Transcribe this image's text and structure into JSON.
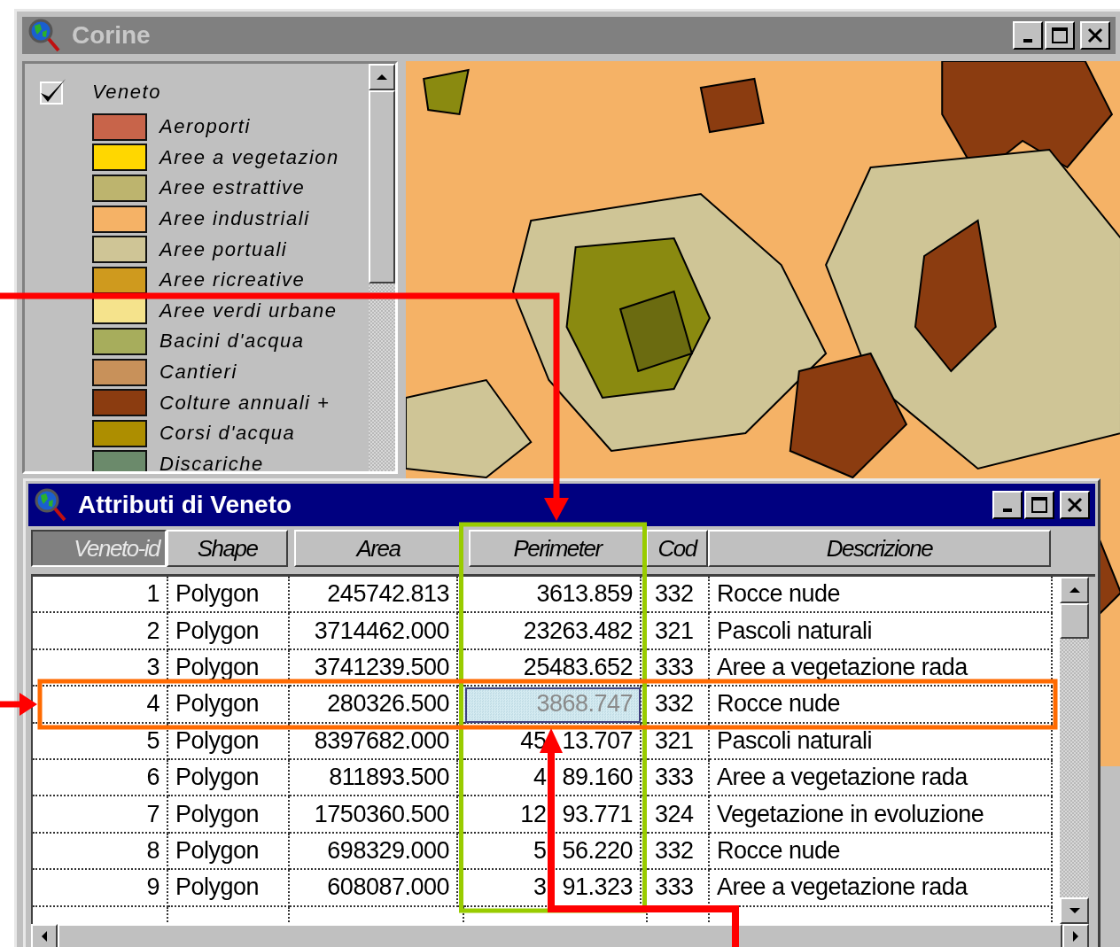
{
  "map_window": {
    "title": "Corine",
    "legend": {
      "layer": {
        "name": "Veneto",
        "visible": true
      },
      "items": [
        {
          "label": "Aeroporti",
          "color": "#c8644a"
        },
        {
          "label": "Aree a vegetazion",
          "color": "#ffd700"
        },
        {
          "label": "Aree estrattive",
          "color": "#bdb46e"
        },
        {
          "label": "Aree industriali",
          "color": "#f5b266"
        },
        {
          "label": "Aree portuali",
          "color": "#cfc596"
        },
        {
          "label": "Aree ricreative",
          "color": "#cf9a1e"
        },
        {
          "label": "Aree verdi urbane",
          "color": "#f5e38c"
        },
        {
          "label": "Bacini d'acqua",
          "color": "#a7ad5c"
        },
        {
          "label": "Cantieri",
          "color": "#c8915a"
        },
        {
          "label": "Colture annuali +",
          "color": "#8b3c10"
        },
        {
          "label": "Corsi d'acqua",
          "color": "#ad8e00"
        },
        {
          "label": "Discariche",
          "color": "#6b8a6b"
        }
      ]
    }
  },
  "table_window": {
    "title": "Attributi di Veneto",
    "columns": [
      {
        "label": "Veneto-id",
        "selected": true
      },
      {
        "label": "Shape",
        "selected": false
      },
      {
        "label": "Area",
        "selected": false
      },
      {
        "label": "Perimeter",
        "selected": false
      },
      {
        "label": "Cod",
        "selected": false
      },
      {
        "label": "Descrizione",
        "selected": false
      }
    ],
    "rows": [
      {
        "id": "1",
        "shape": "Polygon",
        "area": "245742.813",
        "perimeter": [
          "3613.859"
        ],
        "code": "332",
        "description": "Rocce nude",
        "cell_selected": false
      },
      {
        "id": "2",
        "shape": "Polygon",
        "area": "3714462.000",
        "perimeter": [
          "23263.482"
        ],
        "code": "321",
        "description": "Pascoli naturali",
        "cell_selected": false
      },
      {
        "id": "3",
        "shape": "Polygon",
        "area": "3741239.500",
        "perimeter": [
          "25483.652"
        ],
        "code": "333",
        "description": "Aree a vegetazione rada",
        "cell_selected": false
      },
      {
        "id": "4",
        "shape": "Polygon",
        "area": "280326.500",
        "perimeter": [
          "3868.747"
        ],
        "code": "332",
        "description": "Rocce nude",
        "cell_selected": true
      },
      {
        "id": "5",
        "shape": "Polygon",
        "area": "8397682.000",
        "perimeter": [
          "45",
          "13.707"
        ],
        "code": "321",
        "description": "Pascoli naturali",
        "cell_selected": false
      },
      {
        "id": "6",
        "shape": "Polygon",
        "area": "811893.500",
        "perimeter": [
          "4",
          "89.160"
        ],
        "code": "333",
        "description": "Aree a vegetazione rada",
        "cell_selected": false
      },
      {
        "id": "7",
        "shape": "Polygon",
        "area": "1750360.500",
        "perimeter": [
          "12",
          "93.771"
        ],
        "code": "324",
        "description": "Vegetazione in evoluzione",
        "cell_selected": false
      },
      {
        "id": "8",
        "shape": "Polygon",
        "area": "698329.000",
        "perimeter": [
          "5",
          "56.220"
        ],
        "code": "332",
        "description": "Rocce nude",
        "cell_selected": false
      },
      {
        "id": "9",
        "shape": "Polygon",
        "area": "608087.000",
        "perimeter": [
          "3",
          "91.323"
        ],
        "code": "333",
        "description": "Aree a vegetazione rada",
        "cell_selected": false
      }
    ]
  }
}
